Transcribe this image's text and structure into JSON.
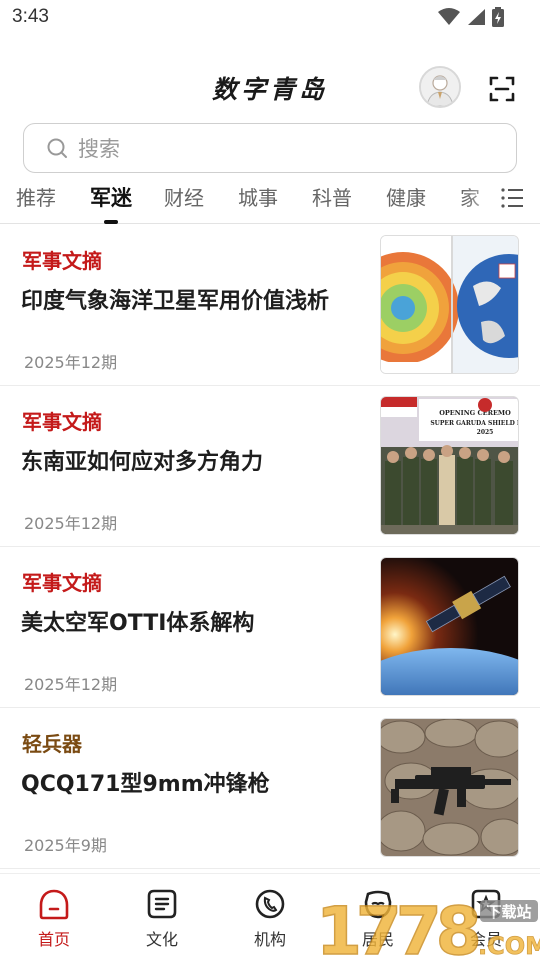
{
  "status": {
    "time": "3:43"
  },
  "header": {
    "title": "数字青岛"
  },
  "search": {
    "placeholder": "搜索"
  },
  "tabs": [
    {
      "label": "推荐"
    },
    {
      "label": "军迷"
    },
    {
      "label": "财经"
    },
    {
      "label": "城事"
    },
    {
      "label": "科普"
    },
    {
      "label": "健康"
    },
    {
      "label": "家"
    }
  ],
  "news": [
    {
      "tag": "军事文摘",
      "title": "印度气象海洋卫星军用价值浅析",
      "date": "2025年12期",
      "thumb": "map"
    },
    {
      "tag": "军事文摘",
      "title": "东南亚如何应对多方角力",
      "date": "2025年12期",
      "thumb": "ceremony",
      "thumb_text": "OPENING CEREMO SUPER GARUDA SHIELD I 2025"
    },
    {
      "tag": "军事文摘",
      "title": "美太空军OTTI体系解构",
      "date": "2025年12期",
      "thumb": "satellite"
    },
    {
      "tag": "轻兵器",
      "title": "QCQ171型9mm冲锋枪",
      "date": "2025年9期",
      "thumb": "gun"
    }
  ],
  "nav": [
    {
      "label": "首页",
      "icon": "home-icon"
    },
    {
      "label": "文化",
      "icon": "culture-icon"
    },
    {
      "label": "机构",
      "icon": "phone-icon"
    },
    {
      "label": "居民",
      "icon": "resident-icon"
    },
    {
      "label": "会员",
      "icon": "member-icon"
    }
  ],
  "watermark": {
    "text": "1778",
    "suffix": "下载站",
    "domain": ".COM"
  },
  "colors": {
    "accent": "#c41a1a",
    "tag_brown": "#7a4a12"
  }
}
